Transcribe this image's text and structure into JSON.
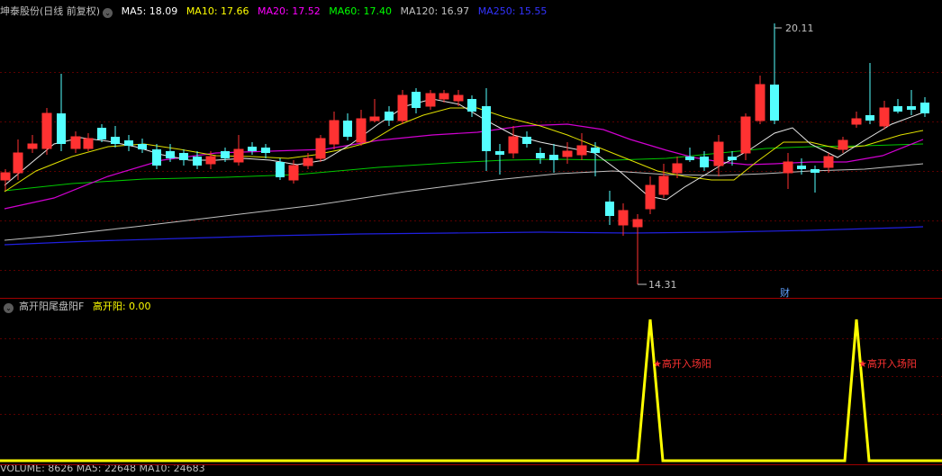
{
  "main_header": {
    "stock_title": "坤泰股份(日线 前复权)",
    "ma_items": [
      {
        "label": "MA5: 18.09",
        "color": "#ffffff"
      },
      {
        "label": "MA10: 17.66",
        "color": "#ffff00"
      },
      {
        "label": "MA20: 17.52",
        "color": "#ff00ff"
      },
      {
        "label": "MA60: 17.40",
        "color": "#00ff00"
      },
      {
        "label": "MA120: 16.97",
        "color": "#c0c0c0"
      },
      {
        "label": "MA250: 15.55",
        "color": "#3333ff"
      }
    ]
  },
  "indicator_header": {
    "name": "高开阳尾盘阳F",
    "value_label": "高开阳: 0.00"
  },
  "volume_header": {
    "label": "VOLUME: 8626  MA5: 22648  MA10: 24683"
  },
  "annotations": {
    "high_price": "20.11",
    "low_price": "14.31",
    "finance_marker": "财",
    "signal_1": "★高开入场阳",
    "signal_2": "★高开入场阳"
  },
  "colors": {
    "up": "#ff3232",
    "down": "#54ffff",
    "signal_line": "#ffff00",
    "signal_text": "#ff3232",
    "grid": "#7a0000"
  },
  "icons": [
    "chevron-down-icon",
    "chevron-down-icon"
  ]
}
